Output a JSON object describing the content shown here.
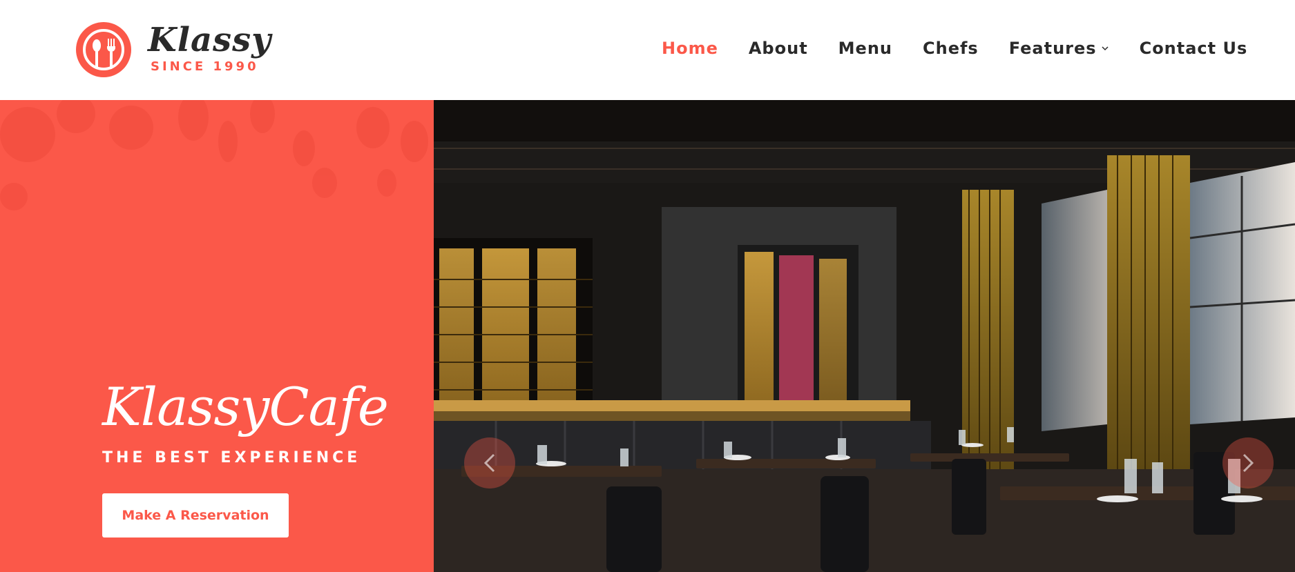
{
  "brand": {
    "logo_word": "Klassy",
    "logo_since": "SINCE 1990",
    "accent_color": "#fb5849"
  },
  "nav": {
    "items": [
      {
        "label": "Home",
        "active": true
      },
      {
        "label": "About",
        "active": false
      },
      {
        "label": "Menu",
        "active": false
      },
      {
        "label": "Chefs",
        "active": false
      },
      {
        "label": "Features",
        "active": false,
        "has_dropdown": true
      },
      {
        "label": "Contact Us",
        "active": false
      }
    ]
  },
  "hero": {
    "title": "KlassyCafe",
    "tagline": "THE BEST EXPERIENCE",
    "cta_label": "Make A Reservation"
  },
  "slider": {
    "prev_icon": "chevron-left-icon",
    "next_icon": "chevron-right-icon"
  }
}
